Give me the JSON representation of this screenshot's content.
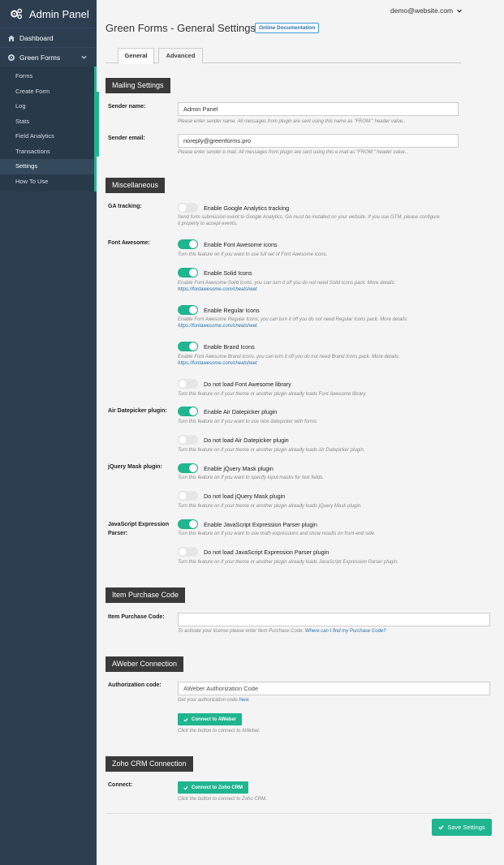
{
  "sidebar": {
    "brand": "Admin Panel",
    "dashboard": "Dashboard",
    "green_forms": "Green Forms",
    "items": [
      "Forms",
      "Create Form",
      "Log",
      "Stats",
      "Field Analytics",
      "Transactions",
      "Settings"
    ],
    "howto": "How To Use"
  },
  "header": {
    "user_email": "demo@website.com",
    "title": "Green Forms - General Settings",
    "doc_link": "Online Documentation"
  },
  "tabs": [
    "General",
    "Advanced"
  ],
  "mailing": {
    "title": "Mailing Settings",
    "sender_name_label": "Sender name:",
    "sender_name_value": "Admin Panel",
    "sender_name_hint": "Please enter sender name. All messages from plugin are sent using this name as \"FROM:\" header value..",
    "sender_email_label": "Sender email:",
    "sender_email_value": "noreply@greenforms.pro",
    "sender_email_hint": "Please enter sender e-mail. All messages from plugin are sent using this e-mail as \"FROM:\" header value.."
  },
  "misc": {
    "title": "Miscellaneous",
    "ga_label": "GA tracking:",
    "ga_toggle": "Enable Google Analytics tracking",
    "ga_hint1": "Send form submission event to Google Analytics. GA must be installed on your website. If you use GTM, please configure",
    "ga_hint2": "it properly to accept events.",
    "fa_label": "Font Awesome:",
    "fa_icons": "Enable Font Awesome icons",
    "fa_icons_hint": "Turn this feature on if you want to use full set of Font Awesome icons.",
    "fa_solid": "Enable Solid Icons",
    "fa_solid_hint": "Enable Font Awesome Solid Icons, you can turn it off you do not need Solid Icons pack. More details:",
    "fa_regular": "Enable Regular Icons",
    "fa_regular_hint": "Enable Font Awesome Regular Icons, you can turn it off you do not need Regular Icons pack. More details:",
    "fa_brand": "Enable Brand Icons",
    "fa_brand_hint": "Enable Font Awesome Brand Icons, you can turn it off you do not need Brand Icons pack. More details:",
    "fa_link": "https://fontawesome.com/cheatsheet",
    "fa_noload": "Do not load Font Awesome library",
    "fa_noload_hint": "Turn this feature on if your theme or another plugin already loads Font Awesome library.",
    "adp_label": "Air Datepicker plugin:",
    "adp_enable": "Enable Air Datepicker plugin",
    "adp_enable_hint": "Turn this feature on if you want to use nice datepicker with forms.",
    "adp_noload": "Do not load Air Datepicker plugin",
    "adp_noload_hint": "Turn this feature on if your theme or another plugin already loads Air Datepicker plugin.",
    "jqm_label": "jQuery Mask plugin:",
    "jqm_enable": "Enable jQuery Mask plugin",
    "jqm_enable_hint": "Turn this feature on if you want to specify input masks for text fields.",
    "jqm_noload": "Do not load jQuery Mask plugin",
    "jqm_noload_hint": "Turn this feature on if your theme or another plugin already loads jQuery Mask plugin.",
    "jsep_label1": "JavaScript Expression",
    "jsep_label2": "Parser:",
    "jsep_enable": "Enable JavaScript Expression Parser plugin",
    "jsep_enable_hint": "Turn this feature on if you want to use math expressions and show results on front-end side.",
    "jsep_noload": "Do not load JavaScript Expression Parser plugin",
    "jsep_noload_hint": "Turn this feature on if your theme or another plugin already loads JavaScript Expression Parser plugin."
  },
  "purchase": {
    "title": "Item Purchase Code",
    "label": "Item Purchase Code:",
    "value": "",
    "hint": "To activate your license please enter Item Purchase Code.",
    "hint_link": "Where can I find my Purchase Code?"
  },
  "aweber": {
    "title": "AWeber Connection",
    "label": "Authorization code:",
    "placeholder": "AWeber Authorization Code",
    "hint": "Get your authorization code",
    "hint_link": "here",
    "button": "Connect to AWeber",
    "button_hint": "Click the button to connect to AWeber."
  },
  "zoho": {
    "title": "Zoho CRM Connection",
    "label": "Connect:",
    "button": "Connect to Zoho CRM",
    "button_hint": "Click the button to connect to Zoho CRM."
  },
  "save_label": "Save Settings",
  "toggles": {
    "ga": false,
    "fa_icons": true,
    "fa_solid": true,
    "fa_regular": true,
    "fa_brand": true,
    "fa_noload": false,
    "adp_enable": true,
    "adp_noload": false,
    "jqm_enable": true,
    "jqm_noload": false,
    "jsep_enable": true,
    "jsep_noload": false
  },
  "colors": {
    "accent": "#1fb58f",
    "sidebar": "#2c3e50",
    "section_head": "#3a3a3a",
    "link": "#2671ac"
  }
}
